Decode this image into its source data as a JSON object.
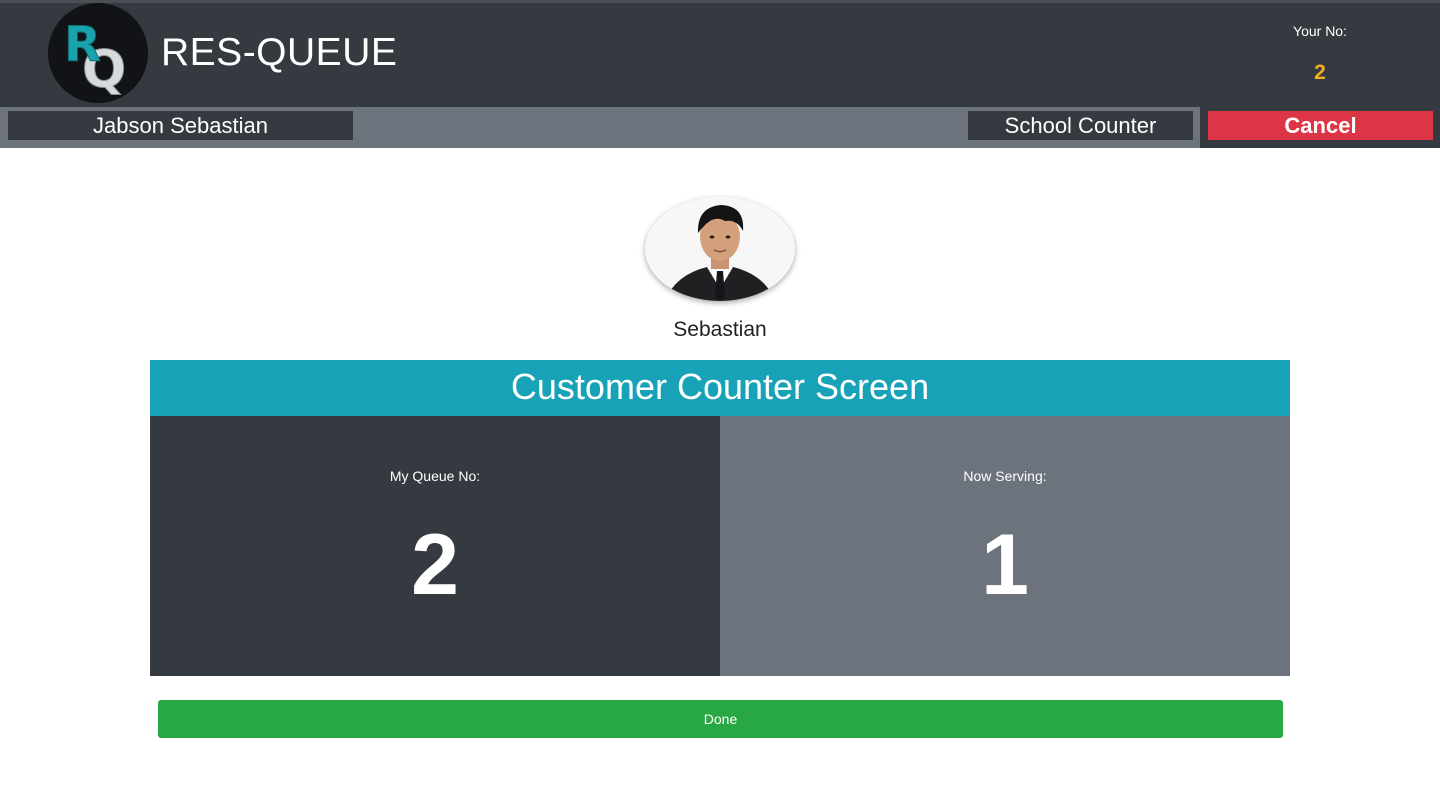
{
  "app": {
    "title": "RES-QUEUE",
    "logo_letters": "RQ"
  },
  "header": {
    "your_no_label": "Your No:",
    "your_no_value": "2"
  },
  "subbar": {
    "customer_name": "Jabson Sebastian",
    "counter_name": "School Counter",
    "cancel_label": "Cancel"
  },
  "staff": {
    "name": "Sebastian"
  },
  "screen": {
    "title": "Customer Counter Screen",
    "my_queue_label": "My Queue No:",
    "my_queue_value": "2",
    "now_serving_label": "Now Serving:",
    "now_serving_value": "1"
  },
  "footer": {
    "done_label": "Done"
  },
  "colors": {
    "header_bg": "#343a40",
    "subbar_bg": "#6c737d",
    "accent_teal": "#17a2b8",
    "cancel_red": "#dc3545",
    "done_green": "#28a745",
    "your_no_yellow": "#f2b01e"
  }
}
